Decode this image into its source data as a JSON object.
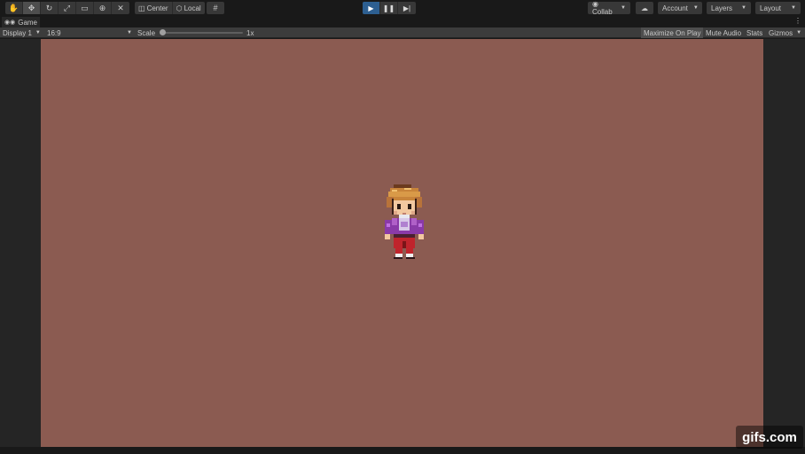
{
  "toolbar": {
    "tools": [
      "hand-tool",
      "move-tool",
      "rotate-tool",
      "scale-tool",
      "rect-tool",
      "transform-tool",
      "custom-tool"
    ],
    "pivot_mode": "Center",
    "pivot_rotation": "Local",
    "collab_label": "Collab",
    "account_label": "Account",
    "layers_label": "Layers",
    "layout_label": "Layout"
  },
  "tab": {
    "title": "Game"
  },
  "gamebar": {
    "display": "Display 1",
    "aspect": "16:9",
    "scale_label": "Scale",
    "scale_value": "1x",
    "maximize_on_play": "Maximize On Play",
    "mute_audio": "Mute Audio",
    "stats": "Stats",
    "gizmos": "Gizmos"
  },
  "colors": {
    "game_background": "#8b5b51",
    "play_active": "#2d5f91",
    "editor_dark": "#191919"
  },
  "watermark": "gifs.com"
}
